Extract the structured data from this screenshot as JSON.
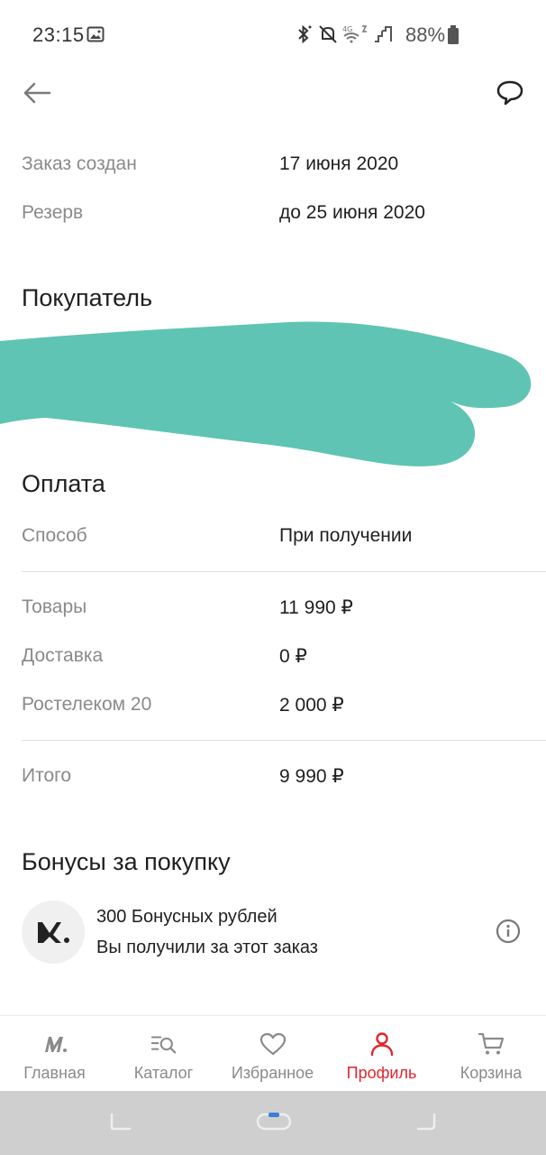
{
  "status_bar": {
    "time": "23:15",
    "battery_percent": "88%",
    "icons": [
      "gallery-icon",
      "bluetooth-icon",
      "mute-icon",
      "wifi-calling-icon",
      "signal-icon",
      "battery-icon"
    ]
  },
  "header": {
    "back_icon": "arrow-left-icon",
    "chat_icon": "chat-bubble-icon"
  },
  "order": {
    "created_label": "Заказ создан",
    "created_value": "17 июня 2020",
    "reserve_label": "Резерв",
    "reserve_value": "до 25 июня 2020"
  },
  "buyer": {
    "title": "Покупатель"
  },
  "payment": {
    "title": "Оплата",
    "method_label": "Способ",
    "method_value": "При получении",
    "goods_label": "Товары",
    "goods_value": "11 990 ₽",
    "delivery_label": "Доставка",
    "delivery_value": "0 ₽",
    "promo_label": "Ростелеком 20",
    "promo_value": "2 000 ₽",
    "total_label": "Итого",
    "total_value": "9 990 ₽"
  },
  "bonus": {
    "title": "Бонусы за покупку",
    "amount_text": "300 Бонусных рублей",
    "description": "Вы получили за этот заказ",
    "logo_text": "M."
  },
  "bottom_nav": {
    "items": [
      {
        "label": "Главная",
        "icon": "m-logo-icon"
      },
      {
        "label": "Каталог",
        "icon": "catalog-search-icon"
      },
      {
        "label": "Избранное",
        "icon": "heart-icon"
      },
      {
        "label": "Профиль",
        "icon": "person-icon"
      },
      {
        "label": "Корзина",
        "icon": "cart-icon"
      }
    ],
    "active_index": 3
  },
  "colors": {
    "accent": "#e0262d",
    "redaction": "#5fc4b3",
    "label_gray": "#8a8a8a"
  }
}
